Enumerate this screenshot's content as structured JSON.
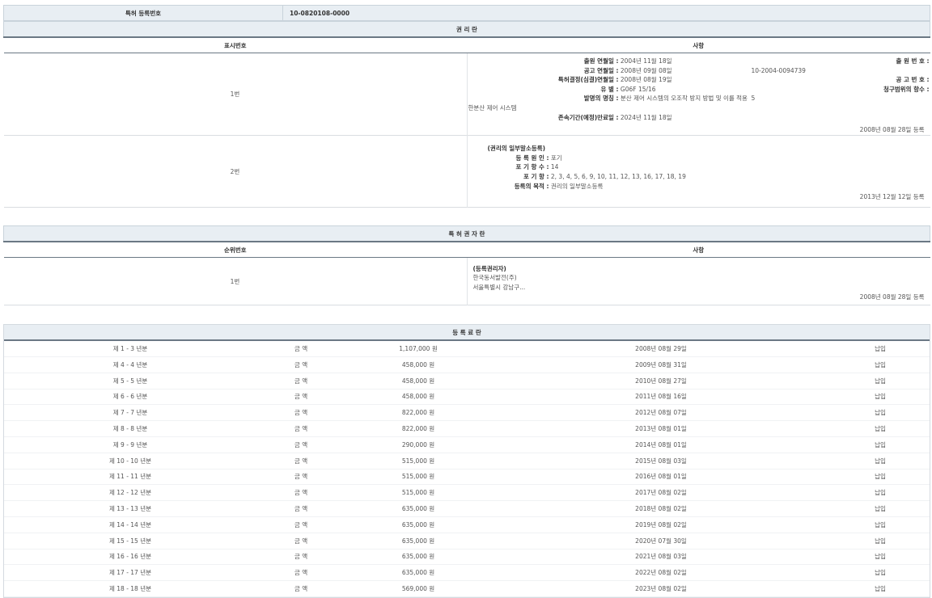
{
  "header": {
    "label": "특허 등록번호",
    "value": "10-0820108-0000"
  },
  "rights": {
    "title": "권 리 란",
    "col_num": "표시번호",
    "col_content": "사항",
    "row1": {
      "num": "1번",
      "left": [
        {
          "k": "출원 연월일 :",
          "v": "2004년 11월 18일"
        },
        {
          "k": "공고 연월일 :",
          "v": "2008년 09월 08일"
        },
        {
          "k": "특허결정(심결)연월일 :",
          "v": "2008년 08월 19일"
        },
        {
          "k": "유 별 :",
          "v": "G06F 15/16"
        },
        {
          "k": "발명의 명칭 :",
          "v": "분산 제어 시스템의 오조작 방지 방법 및 이를 적용한분산 제어 시스템"
        },
        {
          "k": "존속기간(예정)만료일 :",
          "v": "2024년 11월 18일"
        }
      ],
      "right": [
        {
          "k": "출 원 번 호 :",
          "v": "10-2004-0094739"
        },
        {
          "k": "공 고 번 호 :",
          "v": ""
        },
        {
          "k": "청구범위의 항수 :",
          "v": "5"
        }
      ],
      "date": "2008년 08월 28일 등록"
    },
    "row2": {
      "num": "2번",
      "heading": "(권리의 일부말소등록)",
      "items": [
        {
          "k": "등 록 원 인 :",
          "v": "포기"
        },
        {
          "k": "포 기 항 수 :",
          "v": "14"
        },
        {
          "k": "포 기 항 :",
          "v": "2, 3, 4, 5, 6, 9, 10, 11, 12, 13, 16, 17, 18, 19"
        },
        {
          "k": "등록의 목적 :",
          "v": "권리의 일부말소등록"
        }
      ],
      "date": "2013년 12월 12일 등록"
    }
  },
  "owners": {
    "title": "특 허 권 자 란",
    "col_num": "순위번호",
    "col_content": "사항",
    "row1": {
      "num": "1번",
      "heading": "(등록권리자)",
      "lines": [
        "한국동서발전(주)",
        "서울특별시 강남구..."
      ],
      "date": "2008년 08월 28일 등록"
    }
  },
  "fees": {
    "title": "등 록 료 란",
    "rows": [
      {
        "period": "제 1 - 3 년분",
        "label": "금 액",
        "amount": "1,107,000 원",
        "date": "2008년 08월 29일",
        "status": "납입"
      },
      {
        "period": "제 4 - 4 년분",
        "label": "금 액",
        "amount": "458,000 원",
        "date": "2009년 08월 31일",
        "status": "납입"
      },
      {
        "period": "제 5 - 5 년분",
        "label": "금 액",
        "amount": "458,000 원",
        "date": "2010년 08월 27일",
        "status": "납입"
      },
      {
        "period": "제 6 - 6 년분",
        "label": "금 액",
        "amount": "458,000 원",
        "date": "2011년 08월 16일",
        "status": "납입"
      },
      {
        "period": "제 7 - 7 년분",
        "label": "금 액",
        "amount": "822,000 원",
        "date": "2012년 08월 07일",
        "status": "납입"
      },
      {
        "period": "제 8 - 8 년분",
        "label": "금 액",
        "amount": "822,000 원",
        "date": "2013년 08월 01일",
        "status": "납입"
      },
      {
        "period": "제 9 - 9 년분",
        "label": "금 액",
        "amount": "290,000 원",
        "date": "2014년 08월 01일",
        "status": "납입"
      },
      {
        "period": "제 10 - 10 년분",
        "label": "금 액",
        "amount": "515,000 원",
        "date": "2015년 08월 03일",
        "status": "납입"
      },
      {
        "period": "제 11 - 11 년분",
        "label": "금 액",
        "amount": "515,000 원",
        "date": "2016년 08월 01일",
        "status": "납입"
      },
      {
        "period": "제 12 - 12 년분",
        "label": "금 액",
        "amount": "515,000 원",
        "date": "2017년 08월 02일",
        "status": "납입"
      },
      {
        "period": "제 13 - 13 년분",
        "label": "금 액",
        "amount": "635,000 원",
        "date": "2018년 08월 02일",
        "status": "납입"
      },
      {
        "period": "제 14 - 14 년분",
        "label": "금 액",
        "amount": "635,000 원",
        "date": "2019년 08월 02일",
        "status": "납입"
      },
      {
        "period": "제 15 - 15 년분",
        "label": "금 액",
        "amount": "635,000 원",
        "date": "2020년 07월 30일",
        "status": "납입"
      },
      {
        "period": "제 16 - 16 년분",
        "label": "금 액",
        "amount": "635,000 원",
        "date": "2021년 08월 03일",
        "status": "납입"
      },
      {
        "period": "제 17 - 17 년분",
        "label": "금 액",
        "amount": "635,000 원",
        "date": "2022년 08월 02일",
        "status": "납입"
      },
      {
        "period": "제 18 - 18 년분",
        "label": "금 액",
        "amount": "569,000 원",
        "date": "2023년 08월 02일",
        "status": "납입"
      }
    ]
  }
}
